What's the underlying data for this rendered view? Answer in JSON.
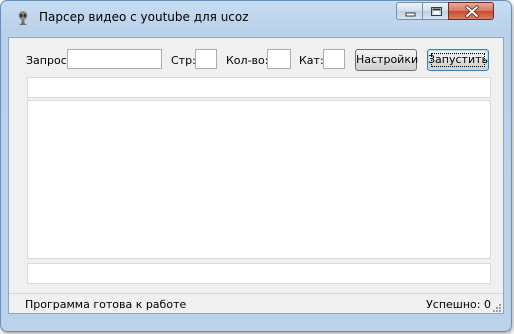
{
  "window": {
    "title": "Парсер видео с youtube для ucoz",
    "icon": "alien-app-icon",
    "controls": [
      "minimize-icon",
      "maximize-icon",
      "close-icon"
    ]
  },
  "toolbar": {
    "query_label": "Запрос:",
    "query_value": "",
    "page_label": "Стр:",
    "page_value": "",
    "count_label": "Кол-во:",
    "count_value": "",
    "category_label": "Кат:",
    "category_value": "",
    "settings_button": "Настройки",
    "run_button": "Запустить"
  },
  "status": {
    "message": "Программа готова к работе",
    "success_text": "Успешно: 0"
  },
  "colors": {
    "frame": "#b9d1ea",
    "client": "#f0f0f0",
    "close_button": "#c74a2c",
    "default_button_border": "#3c7fb1"
  }
}
